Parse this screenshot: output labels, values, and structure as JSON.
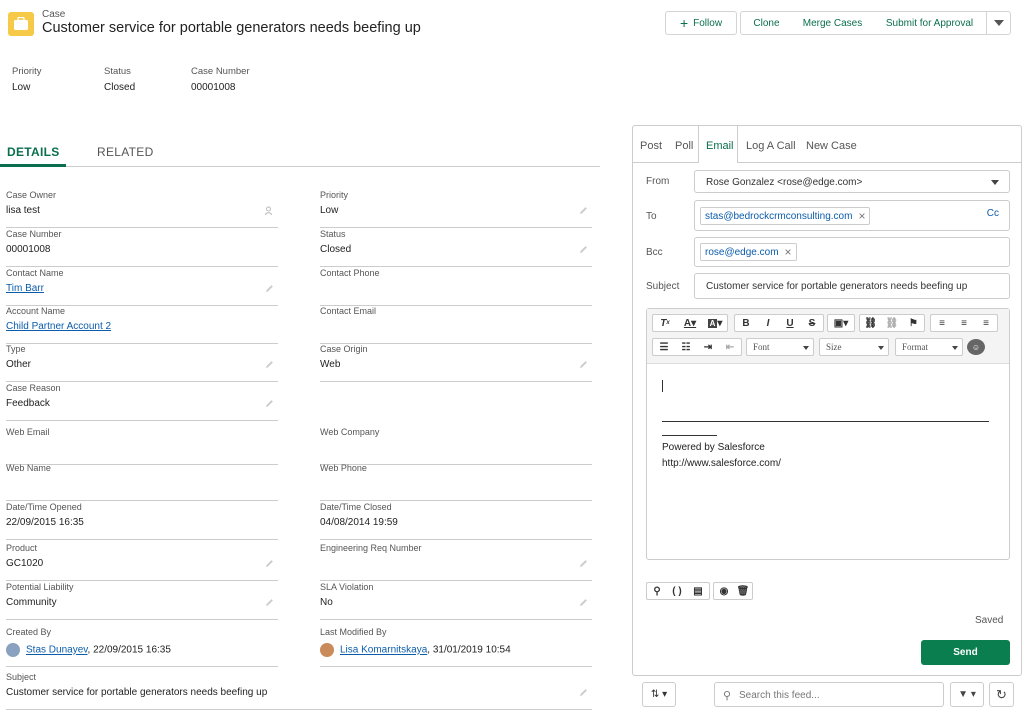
{
  "header": {
    "object_label": "Case",
    "title": "Customer service for portable generators needs beefing up",
    "buttons": {
      "follow": "Follow",
      "clone": "Clone",
      "merge": "Merge Cases",
      "submit": "Submit for Approval"
    }
  },
  "highlights": [
    {
      "label": "Priority",
      "value": "Low"
    },
    {
      "label": "Status",
      "value": "Closed"
    },
    {
      "label": "Case Number",
      "value": "00001008"
    }
  ],
  "tabs": {
    "details": "DETAILS",
    "related": "RELATED"
  },
  "fields": {
    "case_owner": {
      "label": "Case Owner",
      "value": "lisa test"
    },
    "priority": {
      "label": "Priority",
      "value": "Low"
    },
    "case_number": {
      "label": "Case Number",
      "value": "00001008"
    },
    "status": {
      "label": "Status",
      "value": "Closed"
    },
    "contact_name": {
      "label": "Contact Name",
      "value": "Tim Barr"
    },
    "contact_phone": {
      "label": "Contact Phone",
      "value": ""
    },
    "account_name": {
      "label": "Account Name",
      "value": "Child Partner Account 2"
    },
    "contact_email": {
      "label": "Contact Email",
      "value": ""
    },
    "type": {
      "label": "Type",
      "value": "Other"
    },
    "case_origin": {
      "label": "Case Origin",
      "value": "Web"
    },
    "case_reason": {
      "label": "Case Reason",
      "value": "Feedback"
    },
    "web_email": {
      "label": "Web Email",
      "value": ""
    },
    "web_company": {
      "label": "Web Company",
      "value": ""
    },
    "web_name": {
      "label": "Web Name",
      "value": ""
    },
    "web_phone": {
      "label": "Web Phone",
      "value": ""
    },
    "date_opened": {
      "label": "Date/Time Opened",
      "value": "22/09/2015 16:35"
    },
    "date_closed": {
      "label": "Date/Time Closed",
      "value": "04/08/2014 19:59"
    },
    "product": {
      "label": "Product",
      "value": "GC1020"
    },
    "eng_req": {
      "label": "Engineering Req Number",
      "value": ""
    },
    "potential_liability": {
      "label": "Potential Liability",
      "value": "Community"
    },
    "sla_violation": {
      "label": "SLA Violation",
      "value": "No"
    },
    "created_by": {
      "label": "Created By",
      "user": "Stas Dunayev",
      "date": ", 22/09/2015 16:35"
    },
    "last_modified_by": {
      "label": "Last Modified By",
      "user": "Lisa Komarnitskaya",
      "date": ", 31/01/2019 10:54"
    },
    "subject": {
      "label": "Subject",
      "value": "Customer service for portable generators needs beefing up"
    }
  },
  "publisher": {
    "tabs": [
      "Post",
      "Poll",
      "Email",
      "Log A Call",
      "New Case"
    ],
    "from_label": "From",
    "from_value": "Rose Gonzalez <rose@edge.com>",
    "to_label": "To",
    "to_pill": "stas@bedrockcrmconsulting.com",
    "cc": "Cc",
    "bcc_label": "Bcc",
    "bcc_pill": "rose@edge.com",
    "subject_label": "Subject",
    "subject_value": "Customer service for portable generators needs beefing up",
    "toolbar": {
      "font": "Font",
      "size": "Size",
      "format": "Format"
    },
    "signature": [
      "Powered by Salesforce",
      "http://www.salesforce.com/"
    ],
    "saved": "Saved",
    "send": "Send"
  },
  "feed": {
    "search_placeholder": "Search this feed..."
  },
  "colors": {
    "accent": "#0b6e4f",
    "link": "#0b5cab",
    "send": "#0b7e50",
    "case_icon": "#f7c948"
  }
}
